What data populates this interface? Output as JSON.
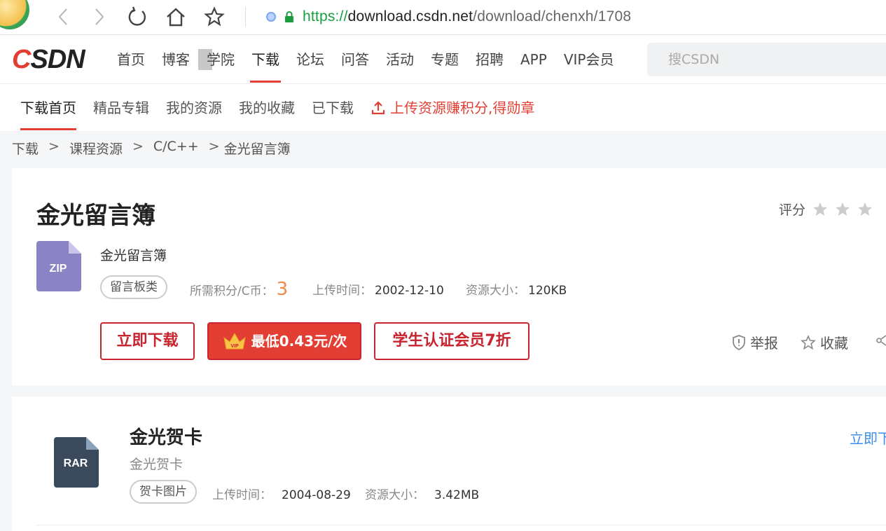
{
  "browser": {
    "url_scheme": "https://",
    "url_host": "download.csdn.net",
    "url_path": "/download/chenxh/1708"
  },
  "header": {
    "logo_c": "C",
    "logo_rest": "SDN",
    "nav": [
      "首页",
      "博客",
      "学院",
      "下载",
      "论坛",
      "问答",
      "活动",
      "专题",
      "招聘",
      "APP",
      "VIP会员"
    ],
    "search_placeholder": "搜CSDN"
  },
  "subnav": {
    "items": [
      "下载首页",
      "精品专辑",
      "我的资源",
      "我的收藏",
      "已下载"
    ],
    "upload": "上传资源赚积分,得勋章"
  },
  "breadcrumb": [
    "下载",
    "课程资源",
    "C/C++",
    "金光留言簿"
  ],
  "resource": {
    "title": "金光留言簿",
    "rating_label": "评分",
    "file_type": "ZIP",
    "description": "金光留言簿",
    "tag": "留言板类",
    "points_label": "所需积分/C币：",
    "points": "3",
    "upload_label": "上传时间：",
    "upload_time": "2002-12-10",
    "size_label": "资源大小：",
    "size": "120KB",
    "btn_download": "立即下载",
    "btn_vip": "最低0.43元/次",
    "btn_student": "学生认证会员7折",
    "report": "举报",
    "favorite": "收藏"
  },
  "related": {
    "file_type": "RAR",
    "title": "金光贺卡",
    "description": "金光贺卡",
    "tag": "贺卡图片",
    "upload_label": "上传时间：",
    "upload_time": "2004-08-29",
    "size_label": "资源大小：",
    "size": "3.42MB",
    "download": "立即下载"
  },
  "colors": {
    "brand": "#e33e33",
    "link": "#3d8ee4",
    "zip": "#8b84c4",
    "rar": "#3a4a5c"
  }
}
